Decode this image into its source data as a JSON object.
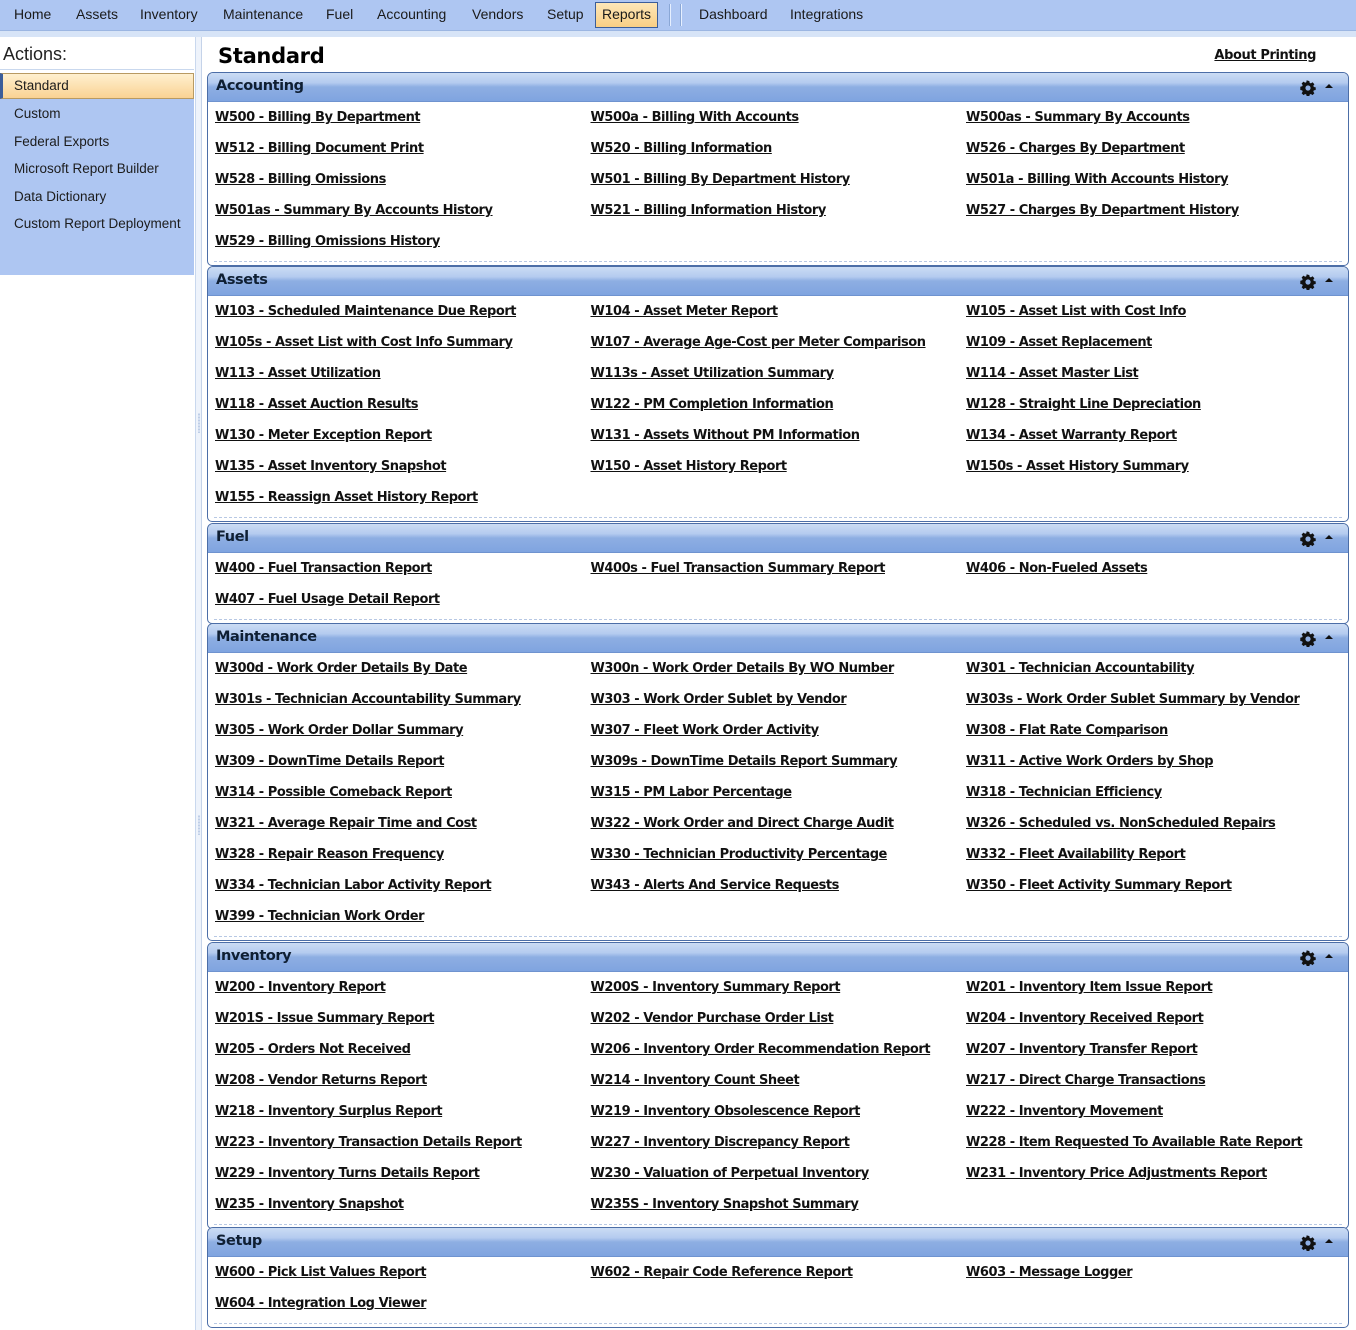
{
  "menu": {
    "items": [
      {
        "label": "Home",
        "active": false
      },
      {
        "label": "Assets",
        "active": false
      },
      {
        "label": "Inventory",
        "active": false
      },
      {
        "label": "Maintenance",
        "active": false
      },
      {
        "label": "Fuel",
        "active": false
      },
      {
        "label": "Accounting",
        "active": false
      },
      {
        "label": "Vendors",
        "active": false
      },
      {
        "label": "Setup",
        "active": false
      },
      {
        "label": "Reports",
        "active": true
      },
      {
        "label": "Dashboard",
        "active": false
      },
      {
        "label": "Integrations",
        "active": false
      }
    ]
  },
  "sidebar": {
    "title": "Actions:",
    "items": [
      {
        "label": "Standard",
        "active": true
      },
      {
        "label": "Custom",
        "active": false
      },
      {
        "label": "Federal Exports",
        "active": false
      },
      {
        "label": "Microsoft Report Builder",
        "active": false
      },
      {
        "label": "Data Dictionary",
        "active": false
      },
      {
        "label": "Custom Report Deployment",
        "active": false
      }
    ]
  },
  "main": {
    "title": "Standard",
    "about_printing": "About Printing",
    "colors": {
      "menu_bg": "#aec6f2",
      "active_bg": "#f9cf85",
      "panel_header": "#7fa4e0",
      "panel_border": "#4c6ea7"
    },
    "sections": [
      {
        "title": "Accounting",
        "reports": [
          "W500 - Billing By Department",
          "W500a - Billing With Accounts",
          "W500as - Summary By Accounts",
          "W512 - Billing Document Print",
          "W520 - Billing Information",
          "W526 - Charges By Department",
          "W528 - Billing Omissions",
          "W501 - Billing By Department History",
          "W501a - Billing With Accounts History",
          "W501as - Summary By Accounts History",
          "W521 - Billing Information History",
          "W527 - Charges By Department History",
          "W529 - Billing Omissions History"
        ]
      },
      {
        "title": "Assets",
        "reports": [
          "W103 - Scheduled Maintenance Due Report",
          "W104 - Asset Meter Report",
          "W105 - Asset List with Cost Info",
          "W105s - Asset List with Cost Info Summary",
          "W107 - Average Age-Cost per Meter Comparison",
          "W109 - Asset Replacement",
          "W113 - Asset Utilization",
          "W113s - Asset Utilization Summary",
          "W114 - Asset Master List",
          "W118 - Asset Auction Results",
          "W122 - PM Completion Information",
          "W128 - Straight Line Depreciation",
          "W130 - Meter Exception Report",
          "W131 - Assets Without PM Information",
          "W134 - Asset Warranty Report",
          "W135 - Asset Inventory Snapshot",
          "W150 - Asset History Report",
          "W150s - Asset History Summary",
          "W155 - Reassign Asset History Report"
        ]
      },
      {
        "title": "Fuel",
        "reports": [
          "W400 - Fuel Transaction Report",
          "W400s - Fuel Transaction Summary Report",
          "W406 - Non-Fueled Assets",
          "W407 - Fuel Usage Detail Report"
        ]
      },
      {
        "title": "Maintenance",
        "reports": [
          "W300d - Work Order Details By Date",
          "W300n - Work Order Details By WO Number",
          "W301 - Technician Accountability",
          "W301s - Technician Accountability Summary",
          "W303 - Work Order Sublet by Vendor",
          "W303s - Work Order Sublet Summary by Vendor",
          "W305 - Work Order Dollar Summary",
          "W307 - Fleet Work Order Activity",
          "W308 - Flat Rate Comparison",
          "W309 - DownTime Details Report",
          "W309s - DownTime Details Report Summary",
          "W311 - Active Work Orders by Shop",
          "W314 - Possible Comeback Report",
          "W315 - PM Labor Percentage",
          "W318 - Technician Efficiency",
          "W321 - Average Repair Time and Cost",
          "W322 - Work Order and Direct Charge Audit",
          "W326 - Scheduled vs. NonScheduled Repairs",
          "W328 - Repair Reason Frequency",
          "W330 - Technician Productivity Percentage",
          "W332 - Fleet Availability Report",
          "W334 - Technician Labor Activity Report",
          "W343 - Alerts And Service Requests",
          "W350 - Fleet Activity Summary Report",
          "W399 - Technician Work Order"
        ]
      },
      {
        "title": "Inventory",
        "reports": [
          "W200 - Inventory Report",
          "W200S - Inventory Summary Report",
          "W201 - Inventory Item Issue Report",
          "W201S - Issue Summary Report",
          "W202 - Vendor Purchase Order List",
          "W204 - Inventory Received Report",
          "W205 - Orders Not Received",
          "W206 - Inventory Order Recommendation Report",
          "W207 - Inventory Transfer Report",
          "W208 - Vendor Returns Report",
          "W214 - Inventory Count Sheet",
          "W217 - Direct Charge Transactions",
          "W218 - Inventory Surplus Report",
          "W219 - Inventory Obsolescence Report",
          "W222 - Inventory Movement",
          "W223 - Inventory Transaction Details Report",
          "W227 - Inventory Discrepancy Report",
          "W228 - Item Requested To Available Rate Report",
          "W229 - Inventory Turns Details Report",
          "W230 - Valuation of Perpetual Inventory",
          "W231 - Inventory Price Adjustments Report",
          "W235 - Inventory Snapshot",
          "W235S - Inventory Snapshot Summary"
        ]
      },
      {
        "title": "Setup",
        "reports": [
          "W600 - Pick List Values Report",
          "W602 - Repair Code Reference Report",
          "W603 - Message Logger",
          "W604 - Integration Log Viewer"
        ]
      }
    ]
  }
}
